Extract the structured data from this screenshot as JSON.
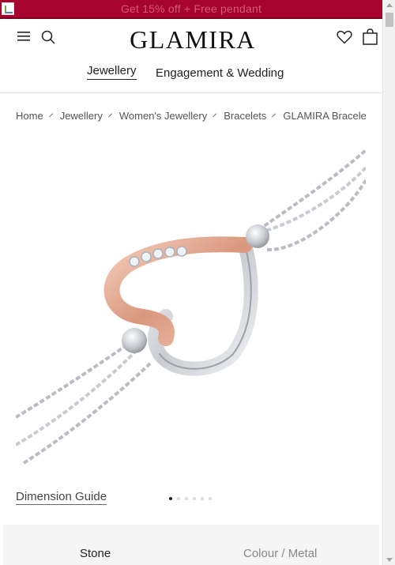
{
  "promo": {
    "text": "Get 15% off + Free pendant"
  },
  "header": {
    "logo": "GLAMIRA",
    "icons": [
      "menu-icon",
      "search-icon",
      "heart-icon",
      "shopping-bag-icon"
    ]
  },
  "nav": {
    "tabs": [
      {
        "label": "Jewellery",
        "active": true
      },
      {
        "label": "Engagement & Wedding",
        "active": false
      }
    ]
  },
  "breadcrumb": {
    "items": [
      "Home",
      "Jewellery",
      "Women's Jewellery",
      "Bracelets",
      "GLAMIRA Bracelet"
    ]
  },
  "gallery": {
    "dimension_guide": "Dimension Guide",
    "slide_count": 6,
    "active_slide": 1
  },
  "options": {
    "tabs": [
      {
        "label": "Stone",
        "active": true
      },
      {
        "label": "Colour / Metal",
        "active": false
      }
    ]
  },
  "colors": {
    "promo_bg": "#a6032f",
    "promo_text": "#d85a73",
    "rose_gold": "#e8b29c",
    "white_gold": "#dcdfe3"
  }
}
